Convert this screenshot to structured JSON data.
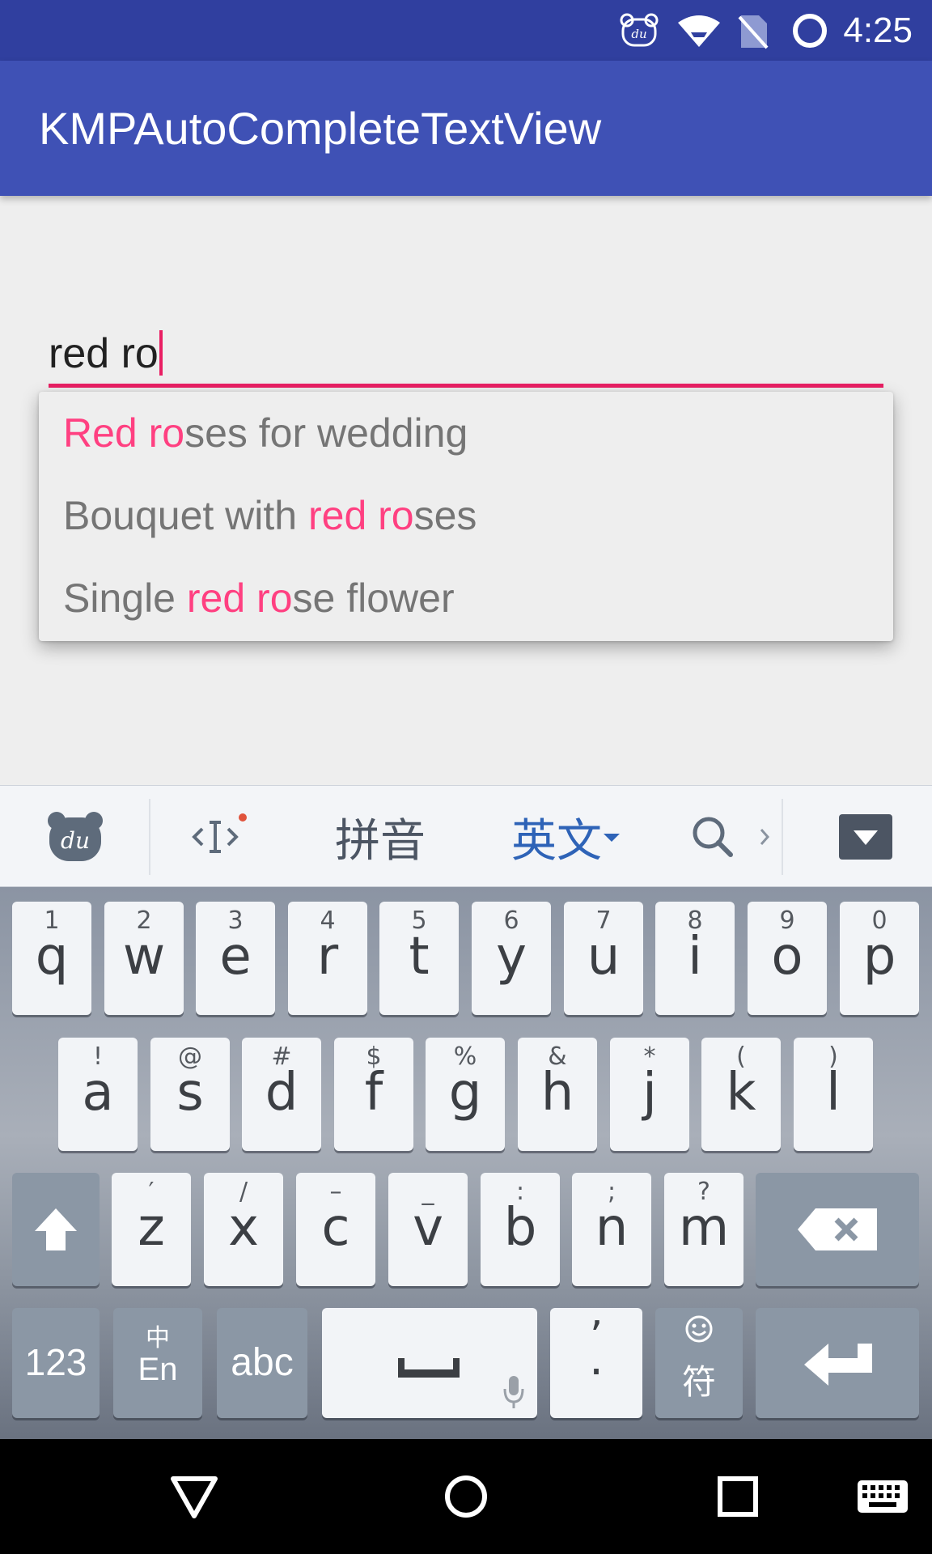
{
  "status_bar": {
    "time": "4:25",
    "icons": [
      "du-bear-icon",
      "wifi-icon",
      "no-sim-icon",
      "circle-icon"
    ]
  },
  "app_bar": {
    "title": "KMPAutoCompleteTextView"
  },
  "input": {
    "value": "red ro",
    "accent_color": "#E91E63"
  },
  "suggestions": [
    {
      "before": "",
      "match": "Red ro",
      "after": "ses for wedding"
    },
    {
      "before": "Bouquet with ",
      "match": "red ro",
      "after": "ses"
    },
    {
      "before": "Single ",
      "match": "red ro",
      "after": "se flower"
    }
  ],
  "suggestion_colors": {
    "match": "#FF4081",
    "text": "#757575"
  },
  "keyboard": {
    "toolbar": {
      "pinyin_label": "拼音",
      "english_label": "英文",
      "icons": [
        "du-logo-icon",
        "cursor-icon",
        "search-icon",
        "chevron-right-icon",
        "hide-keyboard-icon"
      ]
    },
    "row1": [
      {
        "hint": "1",
        "label": "q"
      },
      {
        "hint": "2",
        "label": "w"
      },
      {
        "hint": "3",
        "label": "e"
      },
      {
        "hint": "4",
        "label": "r"
      },
      {
        "hint": "5",
        "label": "t"
      },
      {
        "hint": "6",
        "label": "y"
      },
      {
        "hint": "7",
        "label": "u"
      },
      {
        "hint": "8",
        "label": "i"
      },
      {
        "hint": "9",
        "label": "o"
      },
      {
        "hint": "0",
        "label": "p"
      }
    ],
    "row2": [
      {
        "hint": "!",
        "label": "a"
      },
      {
        "hint": "@",
        "label": "s"
      },
      {
        "hint": "#",
        "label": "d"
      },
      {
        "hint": "$",
        "label": "f"
      },
      {
        "hint": "%",
        "label": "g"
      },
      {
        "hint": "&",
        "label": "h"
      },
      {
        "hint": "*",
        "label": "j"
      },
      {
        "hint": "(",
        "label": "k"
      },
      {
        "hint": ")",
        "label": "l"
      }
    ],
    "row3": [
      {
        "hint": "′",
        "label": "z"
      },
      {
        "hint": "/",
        "label": "x"
      },
      {
        "hint": "–",
        "label": "c"
      },
      {
        "hint": "_",
        "label": "v"
      },
      {
        "hint": ":",
        "label": "b"
      },
      {
        "hint": ";",
        "label": "n"
      },
      {
        "hint": "?",
        "label": "m"
      }
    ],
    "bottom": {
      "numbers_label": "123",
      "lang_top": "中",
      "lang_bottom": "En",
      "abc_label": "abc",
      "punct_top": "’",
      "punct_bottom": "·",
      "symbol_label": "符"
    }
  },
  "nav_bar": {
    "icons": [
      "back-icon",
      "home-icon",
      "recents-icon",
      "keyboard-switch-icon"
    ]
  }
}
